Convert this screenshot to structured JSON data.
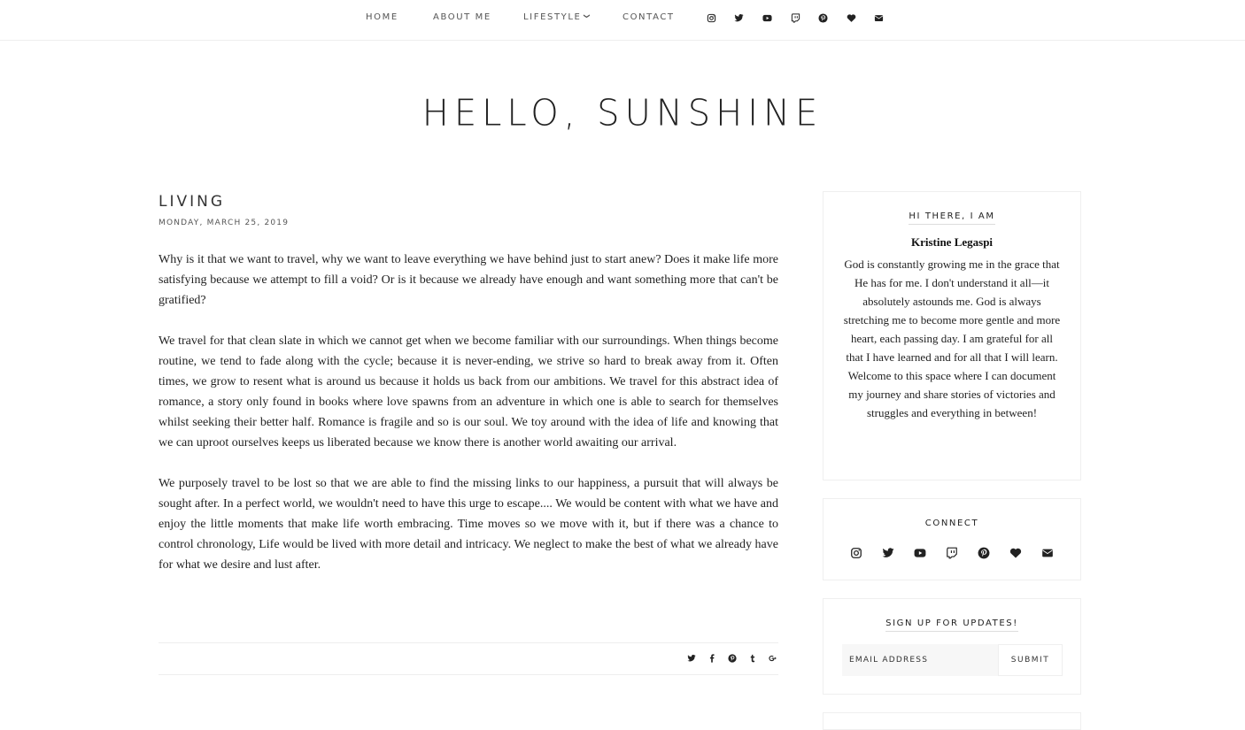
{
  "nav": {
    "items": [
      {
        "label": "HOME"
      },
      {
        "label": "ABOUT ME"
      },
      {
        "label": "LIFESTYLE",
        "caret": "❯"
      },
      {
        "label": "CONTACT"
      }
    ],
    "social_icons": [
      "instagram-icon",
      "twitter-icon",
      "youtube-icon",
      "twitch-icon",
      "pinterest-icon",
      "heart-icon",
      "email-icon"
    ]
  },
  "blog": {
    "title": "HELLO, SUNSHINE"
  },
  "post": {
    "title": "LIVING",
    "date": "MONDAY, MARCH 25, 2019",
    "paragraphs": [
      "Why is it that we want to travel, why we want to leave everything we have behind just to start anew? Does it make life more satisfying because we attempt to fill a void? Or is it because we already have enough and want something more that can't be gratified?",
      "We travel for that clean slate in which we cannot get when we become familiar with our surroundings. When things become routine, we tend to fade along with the cycle; because it is never-ending, we strive so hard to break away from it. Often times, we grow to resent what is around us because it holds us back from our ambitions. We travel for this abstract idea of romance, a story only found in books where love spawns from an adventure in which one is able to search for themselves whilst seeking their better half. Romance is fragile and so is our soul. We toy around with the idea of life and knowing that we can uproot ourselves keeps us liberated because we know there is another world awaiting our arrival.",
      "We purposely travel to be lost so that we are able to find the missing links to our happiness, a pursuit that will always be sought after. In a perfect world, we wouldn't need to have this urge to escape.... We would be content with what we have and enjoy the little moments that make life worth embracing. Time moves so we move with it, but if there was a chance to control chronology, Life would be lived with more detail and intricacy. We neglect to make the best of what we already have for what we desire and lust after."
    ],
    "share_icons": [
      "twitter-icon",
      "facebook-icon",
      "pinterest-icon",
      "tumblr-icon",
      "google-plus-icon"
    ]
  },
  "sidebar": {
    "about": {
      "title": "HI THERE, I AM",
      "name": "Kristine Legaspi",
      "text": "God is constantly growing me in the grace that He has for me. I don't understand it all—it absolutely astounds me. God is always stretching me to become more gentle and more heart, each passing day. I am grateful for all that I have learned and for all that I will learn. Welcome to this space where I can document my journey and share stories of victories and struggles and everything in between!"
    },
    "connect": {
      "title": "CONNECT",
      "icons": [
        "instagram-icon",
        "twitter-icon",
        "youtube-icon",
        "twitch-icon",
        "pinterest-icon",
        "heart-icon",
        "email-icon"
      ]
    },
    "signup": {
      "title": "SIGN UP FOR UPDATES!",
      "placeholder": "EMAIL ADDRESS",
      "submit_label": "SUBMIT"
    }
  },
  "colors": {
    "text": "#222222",
    "muted": "#555555",
    "border": "#eeeeee",
    "input_bg": "#f7f7f7"
  }
}
